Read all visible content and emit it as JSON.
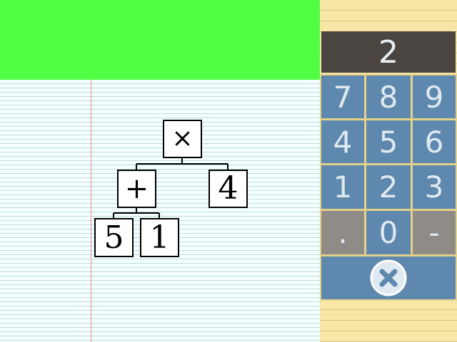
{
  "expression_tree": {
    "root": "×",
    "add_node": "+",
    "right_leaf": "4",
    "left_leaf_a": "5",
    "left_leaf_b": "1"
  },
  "keypad": {
    "display_value": "2",
    "keys": {
      "k7": "7",
      "k8": "8",
      "k9": "9",
      "k4": "4",
      "k5": "5",
      "k6": "6",
      "k1": "1",
      "k2": "2",
      "k3": "3",
      "dot": ".",
      "k0": "0",
      "minus": "-"
    },
    "delete_icon": "close-circle-icon"
  },
  "colors": {
    "banner": "#50ff44",
    "key_blue": "#5e88ad",
    "key_gray": "#8f8b86",
    "display_bg": "#4a4540"
  }
}
